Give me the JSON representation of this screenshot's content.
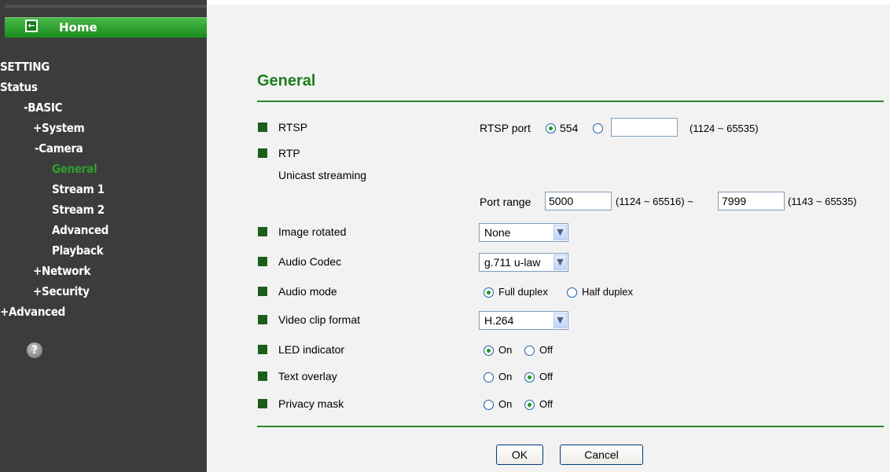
{
  "sidebar": {
    "home_label": "Home",
    "items": [
      {
        "label": "SETTING"
      },
      {
        "label": "Status"
      },
      {
        "label": "-BASIC"
      },
      {
        "label": "+System"
      },
      {
        "label": "-Camera"
      },
      {
        "label": "General"
      },
      {
        "label": "Stream 1"
      },
      {
        "label": "Stream 2"
      },
      {
        "label": "Advanced"
      },
      {
        "label": "Playback"
      },
      {
        "label": "+Network"
      },
      {
        "label": "+Security"
      },
      {
        "label": "+Advanced"
      }
    ],
    "help_glyph": "?"
  },
  "main": {
    "title": "General",
    "rtsp": {
      "label": "RTSP",
      "port_label": "RTSP port",
      "default_port": "554",
      "custom_value": "",
      "range": "(1124 ~ 65535)"
    },
    "rtp": {
      "label": "RTP",
      "sublabel": "Unicast streaming",
      "port_range_label": "Port range",
      "start_value": "5000",
      "start_range": "(1124 ~ 65516) ~",
      "end_value": "7999",
      "end_range": "(1143 ~ 65535)"
    },
    "image_rotated": {
      "label": "Image rotated",
      "value": "None"
    },
    "audio_codec": {
      "label": "Audio Codec",
      "value": "g.711 u-law"
    },
    "audio_mode": {
      "label": "Audio mode",
      "opt1": "Full duplex",
      "opt2": "Half duplex",
      "selected": "Full duplex"
    },
    "video_clip_format": {
      "label": "Video clip format",
      "value": "H.264"
    },
    "led_indicator": {
      "label": "LED indicator",
      "on": "On",
      "off": "Off",
      "selected": "On"
    },
    "text_overlay": {
      "label": "Text overlay",
      "on": "On",
      "off": "Off",
      "selected": "Off"
    },
    "privacy_mask": {
      "label": "Privacy mask",
      "on": "On",
      "off": "Off",
      "selected": "Off"
    },
    "ok_label": "OK",
    "cancel_label": "Cancel"
  },
  "colors": {
    "accent_green": "#1e7e1e",
    "sidebar_bg": "#3c3c3c",
    "active_nav": "#2e9e2e"
  }
}
